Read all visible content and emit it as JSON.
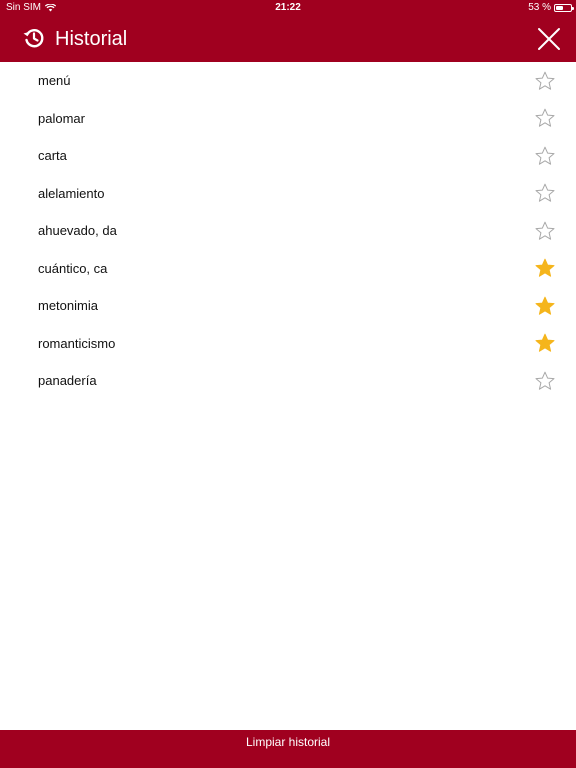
{
  "status_bar": {
    "carrier": "Sin SIM",
    "time": "21:22",
    "battery_text": "53 %",
    "battery_level": 0.53
  },
  "header": {
    "title": "Historial",
    "history_icon": "history-clock-icon",
    "close_icon": "close-x-icon"
  },
  "history": {
    "items": [
      {
        "label": "menú",
        "favorite": false
      },
      {
        "label": "palomar",
        "favorite": false
      },
      {
        "label": "carta",
        "favorite": false
      },
      {
        "label": "alelamiento",
        "favorite": false
      },
      {
        "label": "ahuevado, da",
        "favorite": false
      },
      {
        "label": "cuántico, ca",
        "favorite": true
      },
      {
        "label": "metonimia",
        "favorite": true
      },
      {
        "label": "romanticismo",
        "favorite": true
      },
      {
        "label": "panadería",
        "favorite": false
      }
    ]
  },
  "footer": {
    "clear_label": "Limpiar historial"
  },
  "colors": {
    "brand": "#a0001f",
    "star_active": "#f5b51c",
    "star_inactive": "#a8a8a8"
  }
}
